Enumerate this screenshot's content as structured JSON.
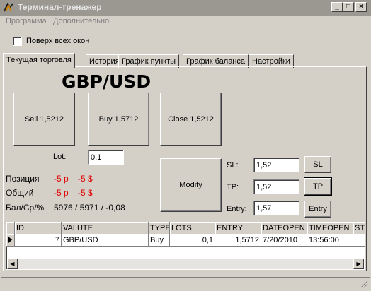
{
  "window": {
    "title": "Терминал-тренажер",
    "controls": [
      "_",
      "□",
      "×"
    ]
  },
  "menu": [
    "Программа",
    "Дополнительно"
  ],
  "always_on_top_label": "Поверх всех окон",
  "tabs": [
    "Текущая торговля",
    "История",
    "График пункты",
    "График баланса",
    "Настройки"
  ],
  "trading": {
    "symbol": "GBP/USD",
    "sell_label": "Sell 1,5212",
    "buy_label": "Buy 1,5712",
    "close_label": "Close 1,5212",
    "lot_label": "Lot:",
    "lot_value": "0,1",
    "modify_label": "Modify",
    "sl_label": "SL:",
    "sl_value": "1,52",
    "sl_button": "SL",
    "tp_label": "TP:",
    "tp_value": "1,52",
    "tp_button": "TP",
    "entry_label": "Entry:",
    "entry_value": "1,57",
    "entry_button": "Entry"
  },
  "stats": {
    "position_label": "Позиция",
    "position_points": "-5 р",
    "position_money": "-5 $",
    "total_label": "Общий",
    "total_points": "-5 р",
    "total_money": "-5 $",
    "balance_label": "Бал/Ср/%",
    "balance_value": "5976 / 5971 / -0,08"
  },
  "grid": {
    "columns": [
      "ID",
      "VALUTE",
      "TYPE",
      "LOTS",
      "ENTRY",
      "DATEOPEN",
      "TIMEOPEN",
      "ST"
    ],
    "rows": [
      [
        "7",
        "GBP/USD",
        "Buy",
        "0,1",
        "1,5712",
        "7/20/2010",
        "13:56:00",
        ""
      ]
    ]
  }
}
